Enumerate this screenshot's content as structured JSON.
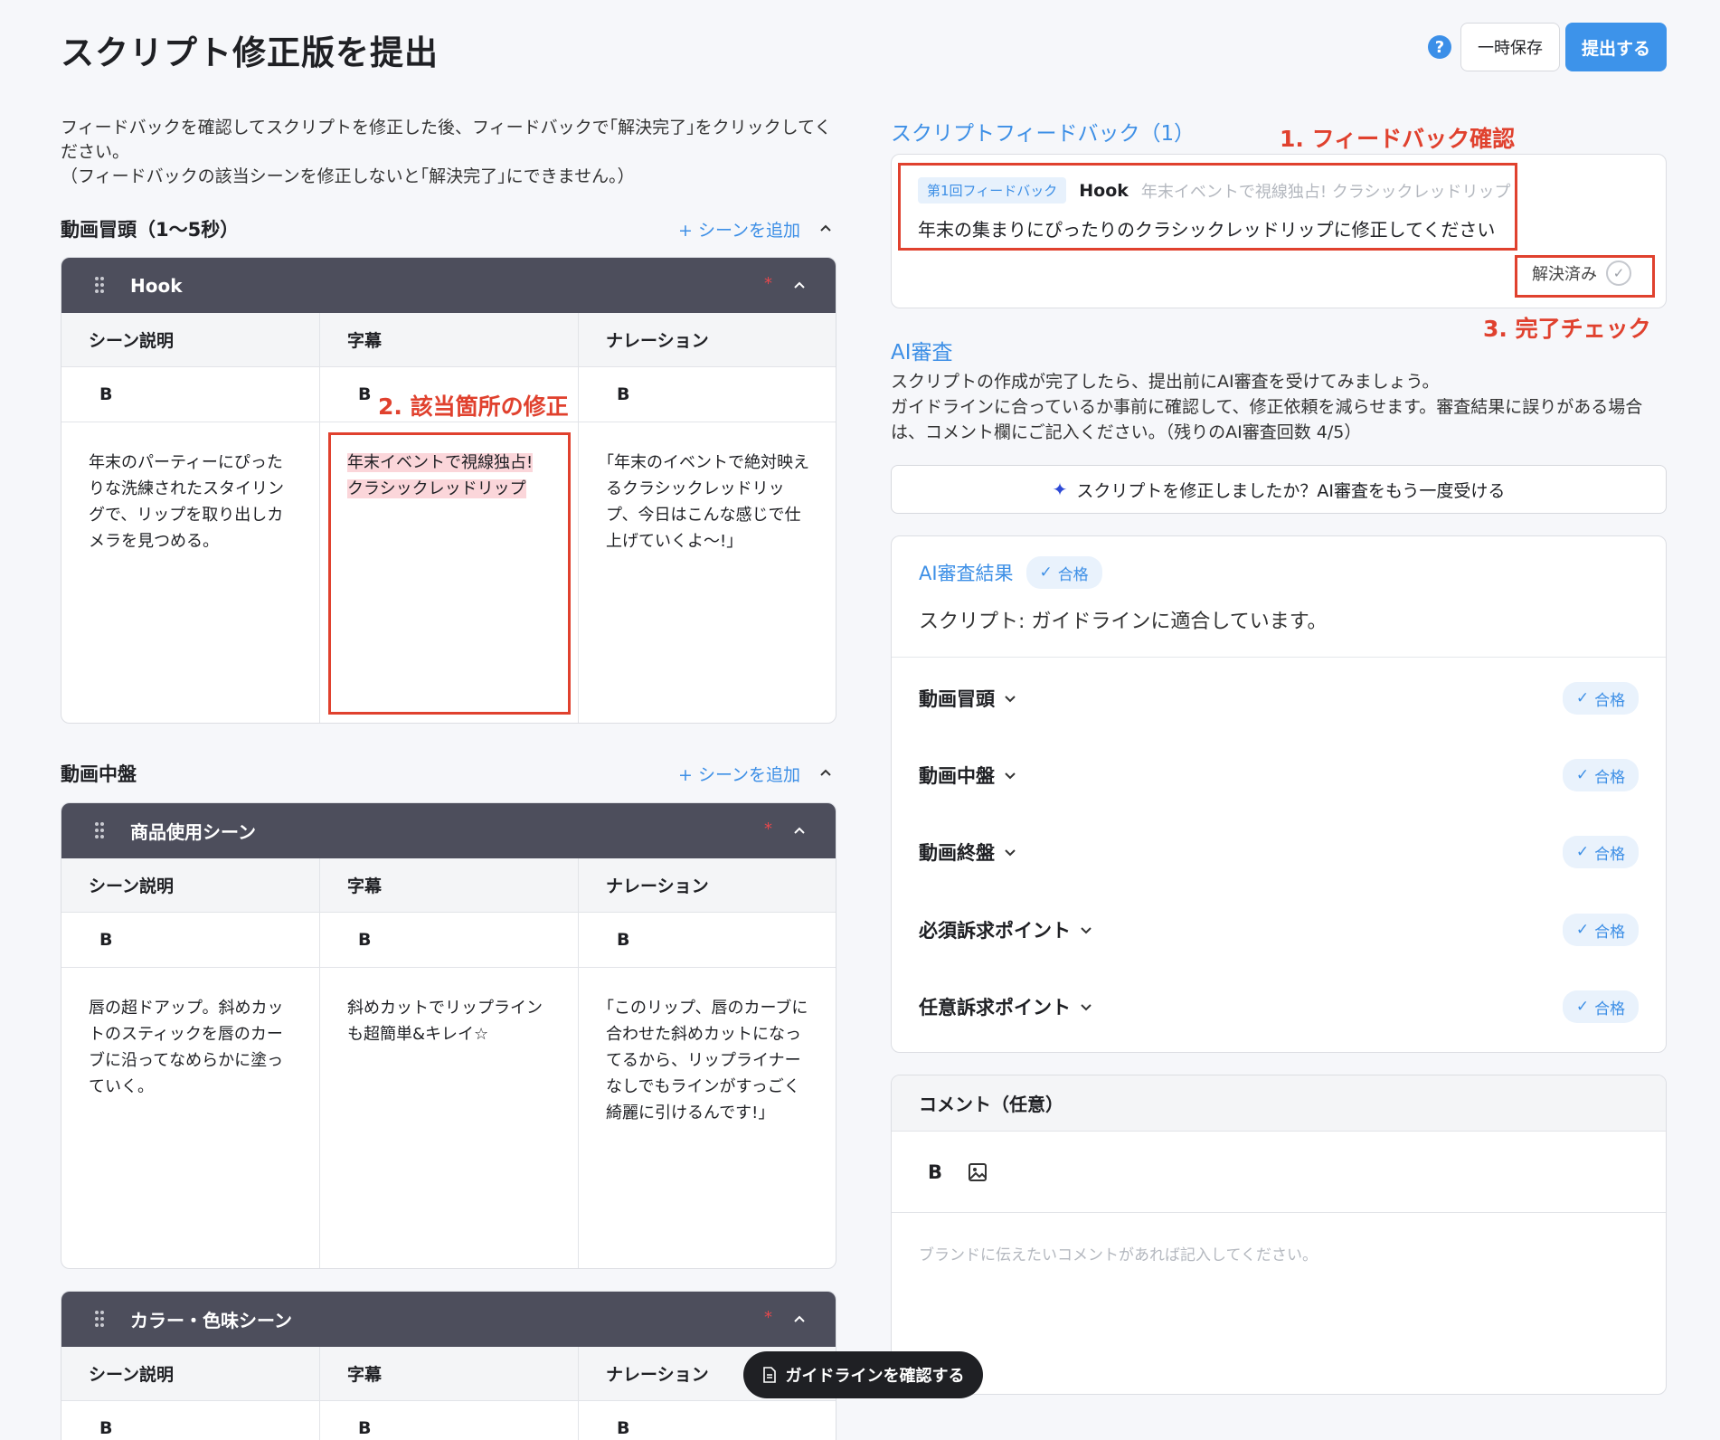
{
  "header": {
    "title": "スクリプト修正版を提出",
    "help_icon": "?",
    "save_label": "一時保存",
    "submit_label": "提出する"
  },
  "intro": {
    "line1": "フィードバックを確認してスクリプトを修正した後、フィードバックで｢解決完了｣をクリックしてください。",
    "line2": "（フィードバックの該当シーンを修正しないと｢解決完了｣にできません。）"
  },
  "columns": [
    "シーン説明",
    "字幕",
    "ナレーション"
  ],
  "bold_label": "B",
  "add_scene_label": "+ シーンを追加",
  "required_mark": "*",
  "sections": [
    {
      "title": "動画冒頭（1〜5秒）",
      "scenes": [
        {
          "name": "Hook",
          "description": "年末のパーティーにぴったりな洗練されたスタイリングで、リップを取り出しカメラを見つめる。",
          "subtitle": "年末イベントで視線独占! クラシックレッドリップ",
          "narration": "｢年末のイベントで絶対映えるクラシックレッドリップ、今日はこんな感じで仕上げていくよ〜!｣"
        }
      ]
    },
    {
      "title": "動画中盤",
      "scenes": [
        {
          "name": "商品使用シーン",
          "description": "唇の超ドアップ。斜めカットのスティックを唇のカーブに沿ってなめらかに塗っていく。",
          "subtitle": "斜めカットでリップラインも超簡単&キレイ☆",
          "narration": "｢このリップ、唇のカーブに合わせた斜めカットになってるから、リップライナーなしでもラインがすっごく綺麗に引けるんです!｣"
        },
        {
          "name": "カラー・色味シーン"
        }
      ]
    }
  ],
  "annotations": {
    "step1": "1. フィードバック確認",
    "step2": "2. 該当箇所の修正",
    "step3": "3. 完了チェック"
  },
  "feedback": {
    "title": "スクリプトフィードバック（1）",
    "tag": "第1回フィードバック",
    "scene": "Hook",
    "quote": "年末イベントで視線独占! クラシックレッドリップ",
    "message": "年末の集まりにぴったりのクラシックレッドリップに修正してください",
    "resolved_label": "解決済み"
  },
  "ai_review": {
    "title": "AI審査",
    "desc1": "スクリプトの作成が完了したら、提出前にAI審査を受けてみましょう。",
    "desc2": "ガイドラインに合っているか事前に確認して、修正依頼を減らせます。審査結果に誤りがある場合は、コメント欄にご記入ください。（残りのAI審査回数 4/5）",
    "button_label": "スクリプトを修正しましたか？AI審査をもう一度受ける",
    "result_title": "AI審査結果",
    "pass_label": "合格",
    "summary": "スクリプト: ガイドラインに適合しています。",
    "categories": [
      "動画冒頭",
      "動画中盤",
      "動画終盤",
      "必須訴求ポイント",
      "任意訴求ポイント"
    ]
  },
  "comment": {
    "title": "コメント（任意）",
    "bold": "B",
    "placeholder": "ブランドに伝えたいコメントがあれば記入してください。"
  },
  "floating": {
    "label": "ガイドラインを確認する"
  },
  "colors": {
    "accent": "#3d8fe6",
    "annotation_red": "#e0412e",
    "scene_header": "#4d4e5c"
  }
}
